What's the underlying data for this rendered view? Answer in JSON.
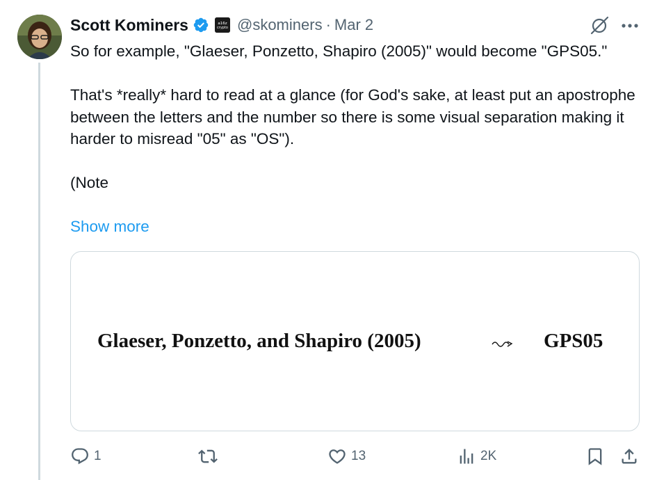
{
  "tweet": {
    "display_name": "Scott Kominers",
    "affiliate_badge_text": "a16z crypto",
    "handle": "@skominers",
    "separator": "·",
    "date": "Mar 2",
    "paragraphs": [
      "So for example, \"Glaeser, Ponzetto, Shapiro (2005)\" would become \"GPS05.\"",
      "That's *really* hard to read at a glance (for God's sake, at least put an apostrophe between the letters and the number so there is some visual separation making it harder to misread \"05\" as \"OS\").",
      "(Note"
    ],
    "show_more": "Show more"
  },
  "media": {
    "left_text": "Glaeser, Ponzetto, and Shapiro (2005)",
    "right_text": "GPS05"
  },
  "actions": {
    "replies": "1",
    "reposts": "",
    "likes": "13",
    "views": "2K"
  },
  "colors": {
    "text": "#0f1419",
    "secondary": "#536471",
    "accent": "#1d9bf0",
    "border": "#cfd9de"
  }
}
